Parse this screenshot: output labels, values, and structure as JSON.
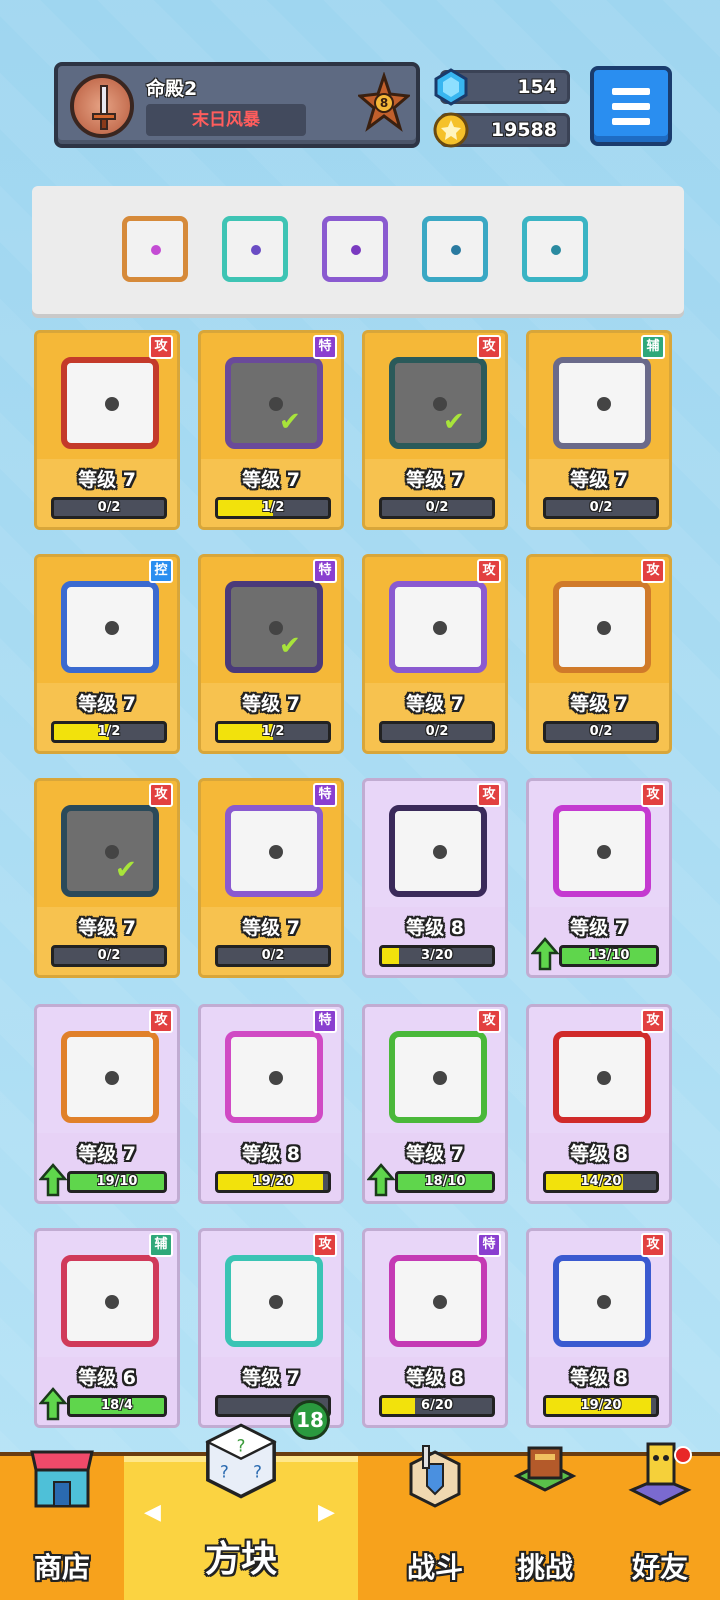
{
  "player": {
    "name": "命殿2",
    "title": "末日风暴",
    "rank": "8"
  },
  "currency": {
    "gems": "154",
    "coins": "19588"
  },
  "colors": {
    "gold_card": "#f6be42",
    "purple_card": "#dcc4ef",
    "attack_tag": "#e24040",
    "special_tag": "#8a3fd0",
    "support_tag": "#2fa87a",
    "control_tag": "#2a8ef0"
  },
  "equipped_slots": [
    {
      "icon": "infinity-dragon-icon"
    },
    {
      "icon": "hands-orb-icon"
    },
    {
      "icon": "purple-orb-dragon-icon"
    },
    {
      "icon": "vortex-dragon-icon"
    },
    {
      "icon": "trident-dragon-icon"
    }
  ],
  "cards": [
    {
      "type": "攻",
      "level": "等级 7",
      "progress": "0/2",
      "fill": 0,
      "frame": "gold",
      "equipped": false
    },
    {
      "type": "特",
      "level": "等级 7",
      "progress": "1/2",
      "fill": 0.5,
      "frame": "gold",
      "equipped": true
    },
    {
      "type": "攻",
      "level": "等级 7",
      "progress": "0/2",
      "fill": 0,
      "frame": "gold",
      "equipped": true
    },
    {
      "type": "辅",
      "level": "等级 7",
      "progress": "0/2",
      "fill": 0,
      "frame": "gold",
      "equipped": false
    },
    {
      "type": "控",
      "level": "等级 7",
      "progress": "1/2",
      "fill": 0.5,
      "frame": "gold",
      "equipped": false
    },
    {
      "type": "特",
      "level": "等级 7",
      "progress": "1/2",
      "fill": 0.5,
      "frame": "gold",
      "equipped": true
    },
    {
      "type": "攻",
      "level": "等级 7",
      "progress": "0/2",
      "fill": 0,
      "frame": "gold",
      "equipped": false
    },
    {
      "type": "攻",
      "level": "等级 7",
      "progress": "0/2",
      "fill": 0,
      "frame": "gold",
      "equipped": false
    },
    {
      "type": "攻",
      "level": "等级 7",
      "progress": "0/2",
      "fill": 0,
      "frame": "gold",
      "equipped": true
    },
    {
      "type": "特",
      "level": "等级 7",
      "progress": "0/2",
      "fill": 0,
      "frame": "gold",
      "equipped": false
    },
    {
      "type": "攻",
      "level": "等级 8",
      "progress": "3/20",
      "fill": 0.15,
      "frame": "purple",
      "equipped": false
    },
    {
      "type": "攻",
      "level": "等级 7",
      "progress": "13/10",
      "fill": 1,
      "frame": "purple",
      "equipped": false,
      "upgrade": true
    },
    {
      "type": "攻",
      "level": "等级 7",
      "progress": "19/10",
      "fill": 1,
      "frame": "purple",
      "equipped": false,
      "upgrade": true
    },
    {
      "type": "特",
      "level": "等级 8",
      "progress": "19/20",
      "fill": 0.95,
      "frame": "purple",
      "equipped": false
    },
    {
      "type": "攻",
      "level": "等级 7",
      "progress": "18/10",
      "fill": 1,
      "frame": "purple",
      "equipped": false,
      "upgrade": true
    },
    {
      "type": "攻",
      "level": "等级 8",
      "progress": "14/20",
      "fill": 0.7,
      "frame": "purple",
      "equipped": false
    },
    {
      "type": "辅",
      "level": "等级 6",
      "progress": "18/4",
      "fill": 1,
      "frame": "purple",
      "equipped": false,
      "upgrade": true
    },
    {
      "type": "攻",
      "level": "等级 7",
      "progress": "",
      "fill": 0,
      "frame": "purple",
      "equipped": false
    },
    {
      "type": "特",
      "level": "等级 8",
      "progress": "6/20",
      "fill": 0.3,
      "frame": "purple",
      "equipped": false
    },
    {
      "type": "攻",
      "level": "等级 8",
      "progress": "19/20",
      "fill": 0.95,
      "frame": "purple",
      "equipped": false
    }
  ],
  "nav": {
    "shop": "商店",
    "blocks": "方块",
    "battle": "战斗",
    "challenge": "挑战",
    "friends": "好友",
    "blocks_badge": "18"
  }
}
